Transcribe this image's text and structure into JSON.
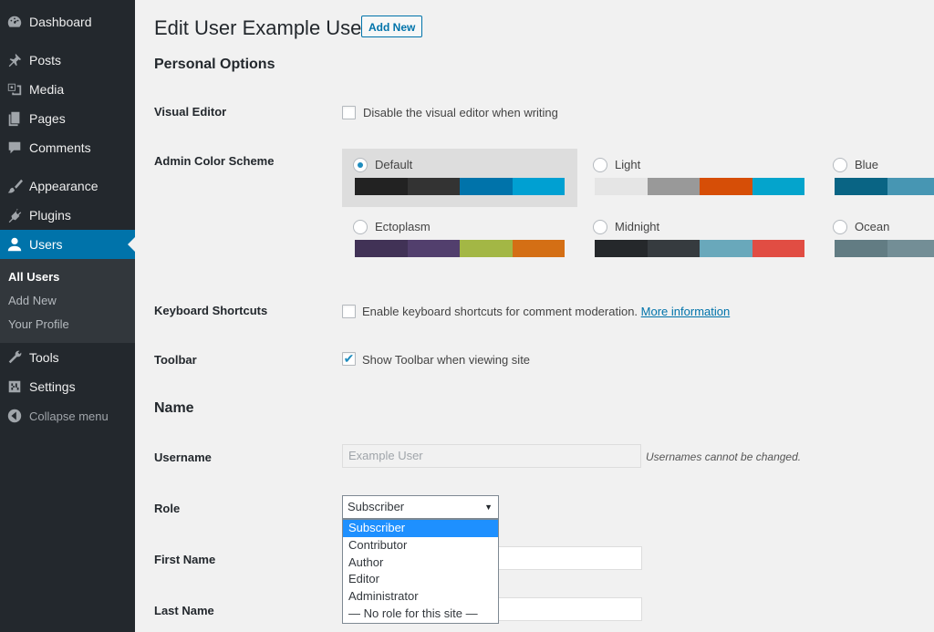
{
  "sidebar": {
    "items": [
      {
        "label": "Dashboard",
        "icon": "dashboard-icon"
      },
      {
        "label": "Posts",
        "icon": "pin-icon"
      },
      {
        "label": "Media",
        "icon": "media-icon"
      },
      {
        "label": "Pages",
        "icon": "pages-icon"
      },
      {
        "label": "Comments",
        "icon": "comment-icon"
      },
      {
        "label": "Appearance",
        "icon": "brush-icon"
      },
      {
        "label": "Plugins",
        "icon": "plugin-icon"
      },
      {
        "label": "Users",
        "icon": "user-icon"
      },
      {
        "label": "Tools",
        "icon": "wrench-icon"
      },
      {
        "label": "Settings",
        "icon": "settings-icon"
      }
    ],
    "users_submenu": [
      "All Users",
      "Add New",
      "Your Profile"
    ],
    "collapse_label": "Collapse menu"
  },
  "header": {
    "title": "Edit User Example User",
    "add_new_label": "Add New"
  },
  "personal_options": {
    "heading": "Personal Options",
    "visual_editor": {
      "label": "Visual Editor",
      "checkbox_text": "Disable the visual editor when writing",
      "checked": false
    },
    "color_scheme": {
      "label": "Admin Color Scheme",
      "selected": "Default",
      "schemes": [
        {
          "name": "Default",
          "colors": [
            "#222222",
            "#333333",
            "#0073aa",
            "#00a0d2"
          ]
        },
        {
          "name": "Light",
          "colors": [
            "#e5e5e5",
            "#999999",
            "#d64e07",
            "#04a4cc"
          ]
        },
        {
          "name": "Blue",
          "colors": [
            "#096484",
            "#4796b3",
            "#52accc",
            "#74b6ce"
          ]
        },
        {
          "name": "Ectoplasm",
          "colors": [
            "#413256",
            "#523f6d",
            "#a3b745",
            "#d46f15"
          ]
        },
        {
          "name": "Midnight",
          "colors": [
            "#25282b",
            "#363b3f",
            "#69a8bb",
            "#e14d43"
          ]
        },
        {
          "name": "Ocean",
          "colors": [
            "#627c83",
            "#738e96",
            "#9ebaa0",
            "#aa9d88"
          ]
        }
      ]
    },
    "keyboard_shortcuts": {
      "label": "Keyboard Shortcuts",
      "checkbox_text": "Enable keyboard shortcuts for comment moderation.",
      "link_text": "More information",
      "checked": false
    },
    "toolbar": {
      "label": "Toolbar",
      "checkbox_text": "Show Toolbar when viewing site",
      "checked": true
    }
  },
  "name_section": {
    "heading": "Name",
    "username": {
      "label": "Username",
      "value": "Example User",
      "description": "Usernames cannot be changed."
    },
    "role": {
      "label": "Role",
      "value": "Subscriber",
      "options": [
        "Subscriber",
        "Contributor",
        "Author",
        "Editor",
        "Administrator",
        "— No role for this site —"
      ]
    },
    "first_name": {
      "label": "First Name",
      "value": ""
    },
    "last_name": {
      "label": "Last Name",
      "value": ""
    }
  },
  "colors": {
    "sidebar_bg": "#23282d",
    "accent": "#0073aa",
    "page_bg": "#f1f1f1"
  }
}
